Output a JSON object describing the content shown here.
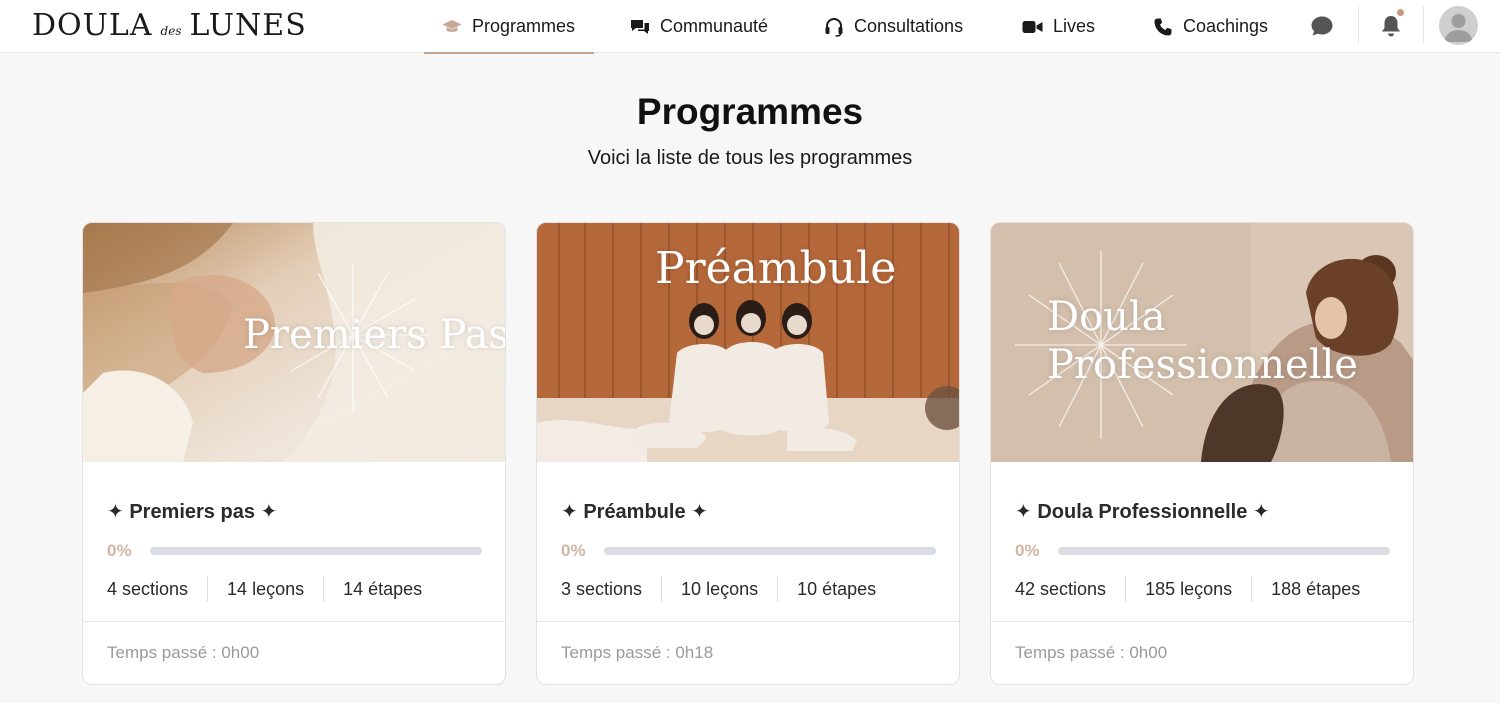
{
  "logo": {
    "part1": "DOULA",
    "part2": "des",
    "part3": "LUNES"
  },
  "nav": {
    "items": [
      {
        "label": "Programmes",
        "icon": "graduation-cap-icon",
        "active": true
      },
      {
        "label": "Communauté",
        "icon": "chat-bubbles-icon",
        "active": false
      },
      {
        "label": "Consultations",
        "icon": "headset-icon",
        "active": false
      },
      {
        "label": "Lives",
        "icon": "video-camera-icon",
        "active": false
      },
      {
        "label": "Coachings",
        "icon": "phone-icon",
        "active": false
      }
    ],
    "icons": [
      "message-icon",
      "bell-icon",
      "avatar"
    ]
  },
  "page": {
    "title": "Programmes",
    "subtitle": "Voici la liste de tous les programmes"
  },
  "programs": [
    {
      "image_title": "Premiers Pas",
      "title": "✦ Premiers pas ✦",
      "progress": 0,
      "progress_label": "0%",
      "sections": "4 sections",
      "lessons": "14 leçons",
      "steps": "14 étapes",
      "time_spent": "Temps passé : 0h00"
    },
    {
      "image_title": "Préambule",
      "title": "✦ Préambule ✦",
      "progress": 0,
      "progress_label": "0%",
      "sections": "3 sections",
      "lessons": "10 leçons",
      "steps": "10 étapes",
      "time_spent": "Temps passé : 0h18"
    },
    {
      "image_title_line1": "Doula",
      "image_title_line2": "Professionnelle",
      "title": "✦ Doula Professionnelle ✦",
      "progress": 0,
      "progress_label": "0%",
      "sections": "42 sections",
      "lessons": "185 leçons",
      "steps": "188 étapes",
      "time_spent": "Temps passé : 0h00"
    }
  ],
  "colors": {
    "accent": "#c4a590",
    "progress_track": "#d9dde3",
    "background": "#f7f7f7"
  }
}
